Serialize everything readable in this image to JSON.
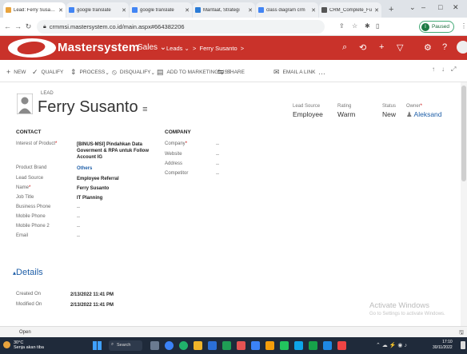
{
  "browser": {
    "tabs": [
      {
        "title": "Lead: Ferry Susanto",
        "fav": "#e8a33d",
        "active": true
      },
      {
        "title": "google translate",
        "fav": "#4285f4",
        "active": false
      },
      {
        "title": "google translate",
        "fav": "#4285f4",
        "active": false
      },
      {
        "title": "Manfaat, Strategi",
        "fav": "#2b7bd6",
        "active": false
      },
      {
        "title": "class diagram crm",
        "fav": "#4285f4",
        "active": false
      },
      {
        "title": "CRM_Complete_Fu",
        "fav": "#555555",
        "active": false
      }
    ],
    "url": "crmmsi.mastersystem.co.id/main.aspx#664382206",
    "profile_status": "Paused",
    "profile_initial": "I"
  },
  "app": {
    "brand": "Mastersystem",
    "area": "Sales",
    "breadcrumb": [
      "Leads",
      "Ferry Susanto"
    ],
    "accent_color": "#c9322a"
  },
  "commands": [
    {
      "icon": "plus-icon",
      "glyph": "+",
      "label": "NEW"
    },
    {
      "icon": "qualify-icon",
      "glyph": "✓",
      "label": "QUALIFY"
    },
    {
      "icon": "process-icon",
      "glyph": "⇕",
      "label": "PROCESS"
    },
    {
      "icon": "disqualify-icon",
      "glyph": "⦸",
      "label": "DISQUALIFY"
    },
    {
      "icon": "marketing-list-icon",
      "glyph": "▤",
      "label": "ADD TO MARKETING LIST"
    },
    {
      "icon": "share-icon",
      "glyph": "⇆",
      "label": "SHARE"
    },
    {
      "icon": "email-link-icon",
      "glyph": "✉",
      "label": "EMAIL A LINK"
    },
    {
      "icon": "more-icon",
      "glyph": "…",
      "label": ""
    }
  ],
  "record": {
    "entity": "LEAD",
    "name": "Ferry Susanto",
    "lead_source": {
      "label": "Lead Source",
      "value": "Employee"
    },
    "rating": {
      "label": "Rating",
      "value": "Warm"
    },
    "status": {
      "label": "Status",
      "value": "New"
    },
    "owner": {
      "label": "Owner",
      "value": "Aleksand"
    }
  },
  "contact": {
    "heading": "CONTACT",
    "fields": [
      {
        "label": "Interest of Product",
        "required": true,
        "value": "[BINUS-MSI] Pindahkan Data Goverment & RPA untuk Follow Account IG",
        "link": false
      },
      {
        "label": "Product Brand",
        "required": false,
        "value": "Others",
        "link": true
      },
      {
        "label": "Lead Source",
        "required": false,
        "value": "Employee Referral",
        "link": false
      },
      {
        "label": "Name",
        "required": true,
        "value": "Ferry Susanto",
        "link": false
      },
      {
        "label": "Job Title",
        "required": false,
        "value": "IT Planning",
        "link": false
      },
      {
        "label": "Business Phone",
        "required": false,
        "value": "--",
        "link": false
      },
      {
        "label": "Mobile Phone",
        "required": false,
        "value": "--",
        "link": false
      },
      {
        "label": "Mobile Phone 2",
        "required": false,
        "value": "--",
        "link": false
      },
      {
        "label": "Email",
        "required": false,
        "value": "--",
        "link": false
      }
    ]
  },
  "company": {
    "heading": "COMPANY",
    "fields": [
      {
        "label": "Company",
        "required": true,
        "value": "--"
      },
      {
        "label": "Website",
        "required": false,
        "value": "--"
      },
      {
        "label": "Address",
        "required": false,
        "value": "--"
      },
      {
        "label": "Competitor",
        "required": false,
        "value": "--"
      }
    ]
  },
  "details": {
    "heading": "Details",
    "fields": [
      {
        "label": "Created On",
        "value": "2/13/2022  11:41 PM"
      },
      {
        "label": "Modified On",
        "value": "2/13/2022  11:41 PM"
      }
    ]
  },
  "watermark": {
    "title": "Activate Windows",
    "subtitle": "Go to Settings to activate Windows."
  },
  "statusbar": {
    "text": "Open"
  },
  "taskbar": {
    "temp": "30°C",
    "weather": "Senja akan tiba",
    "search": "Search",
    "time": "17:10",
    "date": "30/11/2022"
  }
}
